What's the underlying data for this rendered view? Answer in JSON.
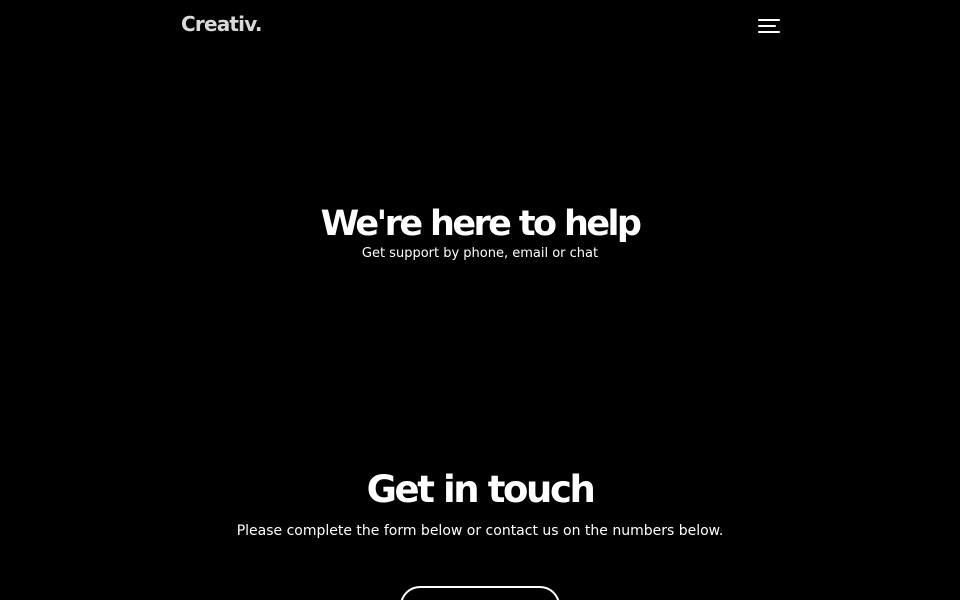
{
  "header": {
    "logo": "Creativ.",
    "menu_icon": "hamburger-menu-icon"
  },
  "hero": {
    "title": "We're here to help",
    "subtitle": "Get support by phone, email or chat"
  },
  "contact": {
    "title": "Get in touch",
    "text": "Please complete the form below or contact us on the numbers below.",
    "button_label": ""
  },
  "colors": {
    "background": "#000000",
    "text": "#ffffff",
    "logo": "#d9d9d9"
  }
}
